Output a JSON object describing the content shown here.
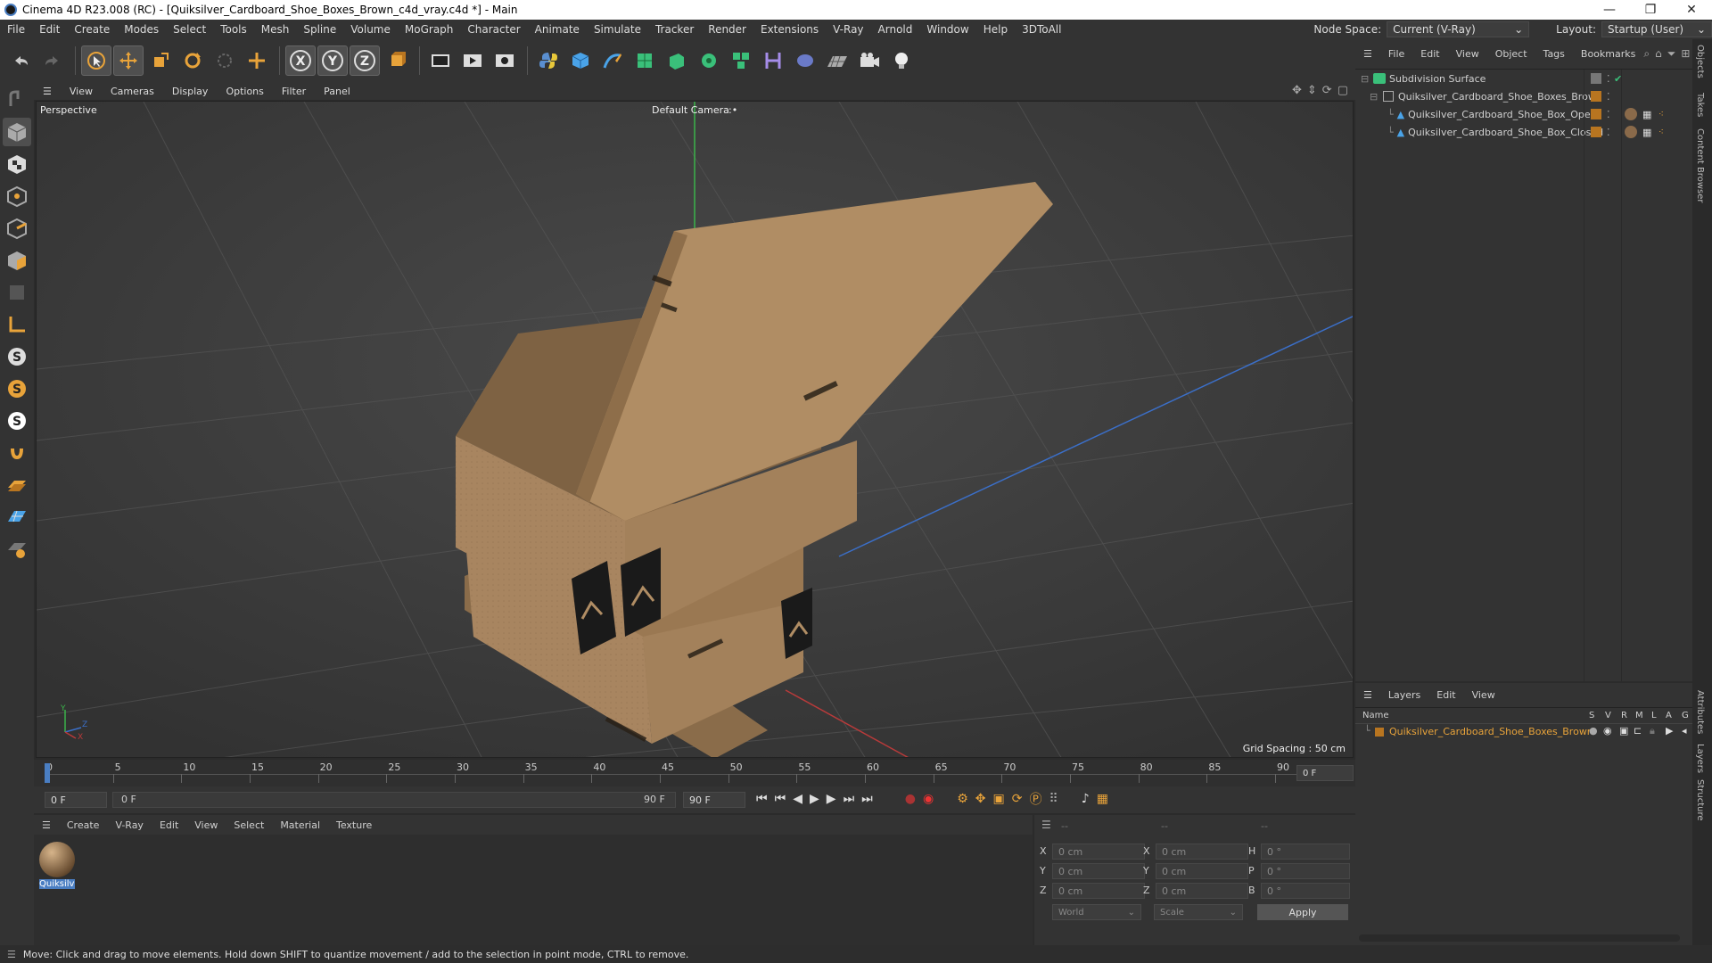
{
  "window": {
    "title": "Cinema 4D R23.008 (RC) - [Quiksilver_Cardboard_Shoe_Boxes_Brown_c4d_vray.c4d *] - Main",
    "controls": [
      "—",
      "❐",
      "✕"
    ]
  },
  "menubar": {
    "items": [
      "File",
      "Edit",
      "Create",
      "Modes",
      "Select",
      "Tools",
      "Mesh",
      "Spline",
      "Volume",
      "MoGraph",
      "Character",
      "Animate",
      "Simulate",
      "Tracker",
      "Render",
      "Extensions",
      "V-Ray",
      "Arnold",
      "Window",
      "Help",
      "3DToAll"
    ],
    "node_space_label": "Node Space:",
    "node_space_value": "Current (V-Ray)",
    "layout_label": "Layout:",
    "layout_value": "Startup (User)"
  },
  "viewport": {
    "menu": [
      "View",
      "Cameras",
      "Display",
      "Options",
      "Filter",
      "Panel"
    ],
    "view_name": "Perspective",
    "camera": "Default Camera",
    "grid_spacing": "Grid Spacing : 50 cm",
    "axis_labels": {
      "y": "Y",
      "z": "Z",
      "x": "X"
    }
  },
  "timeline": {
    "ticks": [
      "0",
      "5",
      "10",
      "15",
      "20",
      "25",
      "30",
      "35",
      "40",
      "45",
      "50",
      "55",
      "60",
      "65",
      "70",
      "75",
      "80",
      "85",
      "90"
    ],
    "current_frame_display": "0 F",
    "start_field": "0 F",
    "range_start": "0 F",
    "range_end": "90 F",
    "end_field": "90 F"
  },
  "material_editor": {
    "menu": [
      "Create",
      "V-Ray",
      "Edit",
      "View",
      "Select",
      "Material",
      "Texture"
    ],
    "material_name": "Quiksilve"
  },
  "coordinates": {
    "header": [
      "--",
      "--",
      "--"
    ],
    "rows": [
      {
        "a": "X",
        "av": "0 cm",
        "b": "X",
        "bv": "0 cm",
        "c": "H",
        "cv": "0 °"
      },
      {
        "a": "Y",
        "av": "0 cm",
        "b": "Y",
        "bv": "0 cm",
        "c": "P",
        "cv": "0 °"
      },
      {
        "a": "Z",
        "av": "0 cm",
        "b": "Z",
        "bv": "0 cm",
        "c": "B",
        "cv": "0 °"
      }
    ],
    "world": "World",
    "scale": "Scale",
    "apply": "Apply"
  },
  "object_manager": {
    "menu": [
      "File",
      "Edit",
      "View",
      "Object",
      "Tags",
      "Bookmarks"
    ],
    "objects": [
      {
        "name": "Subdivision Surface",
        "depth": 0
      },
      {
        "name": "Quiksilver_Cardboard_Shoe_Boxes_Brown",
        "depth": 1
      },
      {
        "name": "Quiksilver_Cardboard_Shoe_Box_Open",
        "depth": 2
      },
      {
        "name": "Quiksilver_Cardboard_Shoe_Box_Closed",
        "depth": 2
      }
    ]
  },
  "layer_manager": {
    "menu": [
      "Layers",
      "Edit",
      "View"
    ],
    "columns": [
      "Name",
      "S",
      "V",
      "R",
      "M",
      "L",
      "A",
      "G"
    ],
    "layer_name": "Quiksilver_Cardboard_Shoe_Boxes_Brown"
  },
  "side_tabs": [
    "Objects",
    "Takes",
    "Content Browser",
    "Attributes",
    "Layers",
    "Structure"
  ],
  "status": "Move: Click and drag to move elements. Hold down SHIFT to quantize movement / add to the selection in point mode, CTRL to remove.",
  "colors": {
    "accent": "#e8a33a",
    "layer_orange": "#e8a33a",
    "bg": "#333333"
  }
}
